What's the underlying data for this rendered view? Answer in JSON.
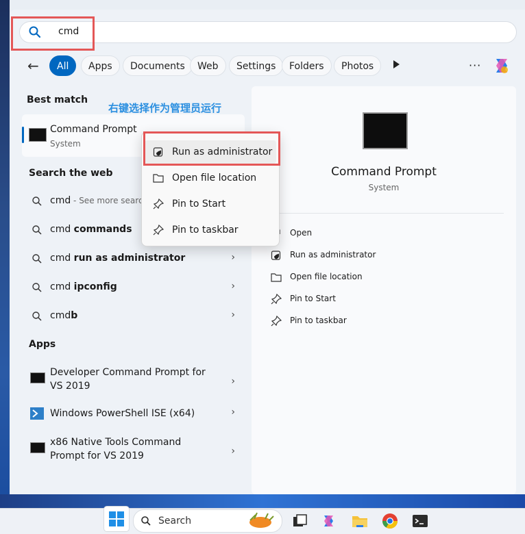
{
  "search": {
    "value": "cmd"
  },
  "annotation": "右键选择作为管理员运行",
  "filters": [
    "All",
    "Apps",
    "Documents",
    "Web",
    "Settings",
    "Folders",
    "Photos"
  ],
  "more_label": "···",
  "best_match": {
    "heading": "Best match",
    "title": "Command Prompt",
    "subtitle": "System"
  },
  "web": {
    "heading": "Search the web",
    "items": [
      {
        "prefix": "cmd",
        "bold": "",
        "suffix": " - See more search r"
      },
      {
        "prefix": "cmd ",
        "bold": "commands",
        "suffix": ""
      },
      {
        "prefix": "cmd ",
        "bold": "run as administrator",
        "suffix": ""
      },
      {
        "prefix": "cmd ",
        "bold": "ipconfig",
        "suffix": ""
      },
      {
        "prefix": "cmd",
        "bold": "b",
        "suffix": ""
      }
    ]
  },
  "apps": {
    "heading": "Apps",
    "items": [
      {
        "line1": "Developer Command Prompt for",
        "line2": "VS 2019"
      },
      {
        "line1": "Windows PowerShell ISE (x64)",
        "line2": ""
      },
      {
        "line1": "x86 Native Tools Command",
        "line2": "Prompt for VS 2019"
      }
    ]
  },
  "detail": {
    "title": "Command Prompt",
    "subtitle": "System",
    "actions": [
      "Open",
      "Run as administrator",
      "Open file location",
      "Pin to Start",
      "Pin to taskbar"
    ]
  },
  "context_menu": [
    "Run as administrator",
    "Open file location",
    "Pin to Start",
    "Pin to taskbar"
  ],
  "taskbar": {
    "search_label": "Search"
  },
  "colors": {
    "accent": "#0067c0",
    "highlight": "#e45757",
    "annotation": "#2b8fe0"
  }
}
